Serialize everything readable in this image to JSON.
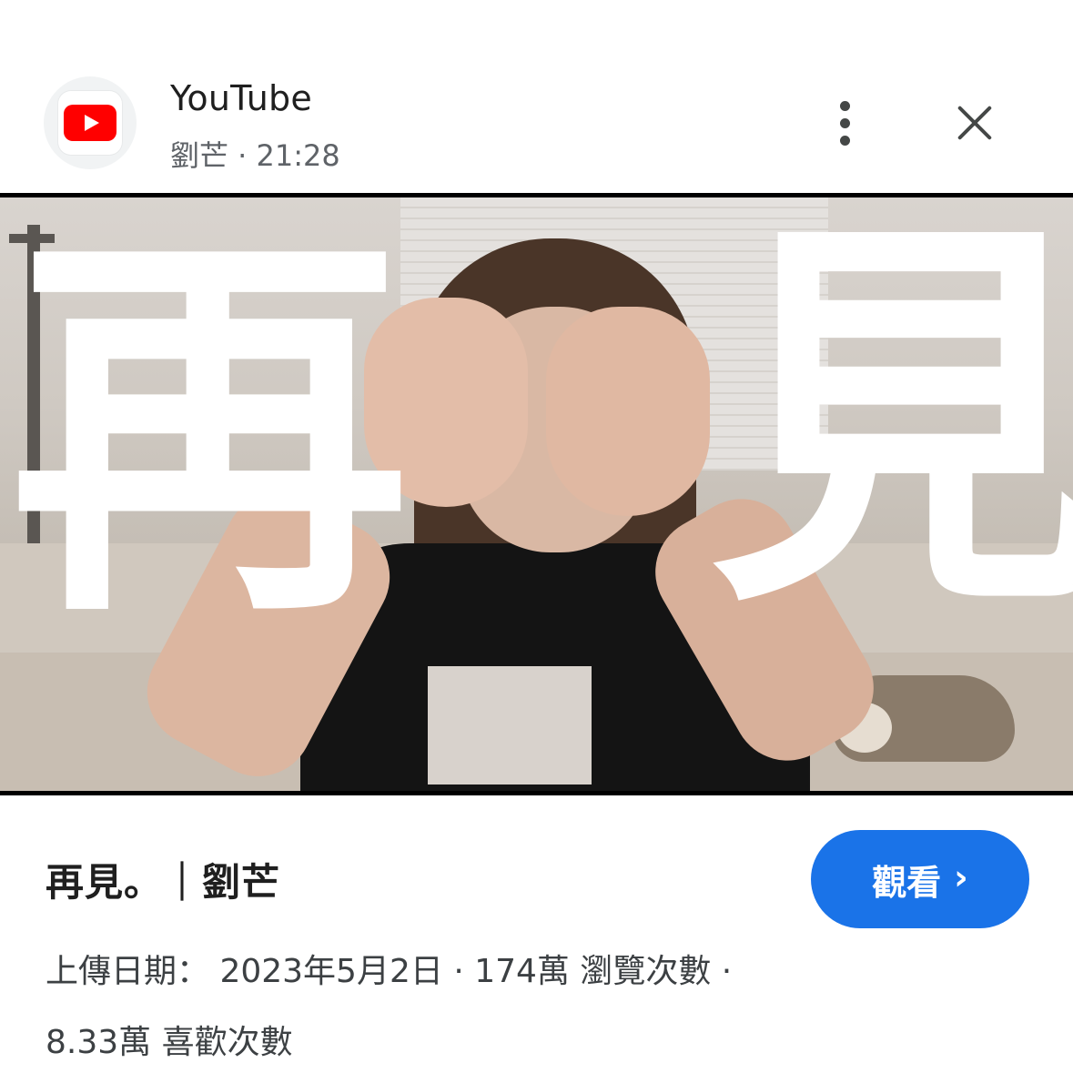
{
  "header": {
    "app_name": "YouTube",
    "subtitle": "劉芒 · 21:28",
    "app_icon": "youtube-logo-icon",
    "more_icon": "more-vert-icon",
    "close_icon": "close-icon"
  },
  "thumbnail": {
    "overlay_char_1": "再",
    "overlay_char_2": "見",
    "lens_icon": "lens-camera-icon"
  },
  "video": {
    "title": "再見。｜劉芒",
    "watch_label": "觀看",
    "watch_chevron": "›",
    "meta_line_1": "上傳日期： 2023年5月2日 · 174萬 瀏覽次數 ·",
    "meta_line_2": "8.33萬 喜歡次數"
  },
  "colors": {
    "accent": "#1a73e8",
    "youtube_red": "#ff0000"
  }
}
